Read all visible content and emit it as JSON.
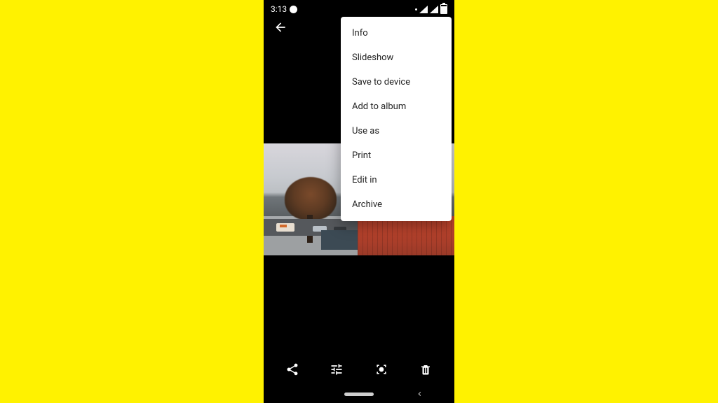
{
  "status": {
    "time": "3:13"
  },
  "menu": {
    "items": [
      "Info",
      "Slideshow",
      "Save to device",
      "Add to album",
      "Use as",
      "Print",
      "Edit in",
      "Archive"
    ]
  }
}
